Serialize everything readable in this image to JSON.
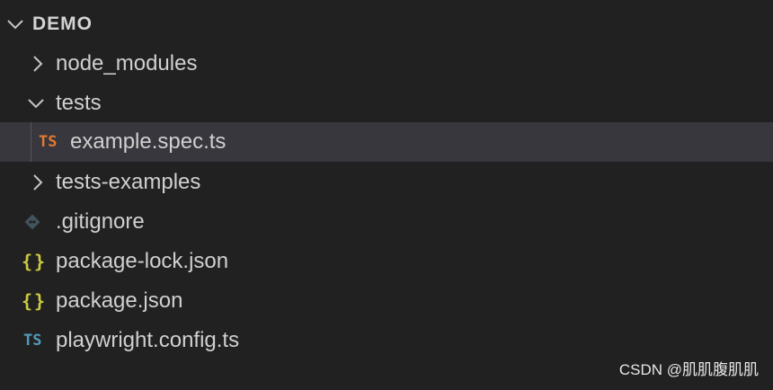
{
  "explorer": {
    "section_title": "DEMO",
    "items": [
      {
        "label": "node_modules",
        "kind": "folder",
        "expanded": false,
        "icon": "chevron-right-icon"
      },
      {
        "label": "tests",
        "kind": "folder",
        "expanded": true,
        "icon": "chevron-down-icon"
      },
      {
        "label": "example.spec.ts",
        "kind": "file",
        "icon_text": "TS",
        "icon": "typescript-icon",
        "selected": true
      },
      {
        "label": "tests-examples",
        "kind": "folder",
        "expanded": false,
        "icon": "chevron-right-icon"
      },
      {
        "label": ".gitignore",
        "kind": "file",
        "icon": "git-icon"
      },
      {
        "label": "package-lock.json",
        "kind": "file",
        "icon_text": "{}",
        "icon": "json-icon"
      },
      {
        "label": "package.json",
        "kind": "file",
        "icon_text": "{}",
        "icon": "json-icon"
      },
      {
        "label": "playwright.config.ts",
        "kind": "file",
        "icon_text": "TS",
        "icon": "typescript-icon"
      }
    ]
  },
  "watermark": "CSDN @肌肌腹肌肌",
  "colors": {
    "background": "#212121",
    "selected_row": "#37373d",
    "ts_orange": "#e37933",
    "ts_blue": "#519aba",
    "json_yellow": "#cbcb41",
    "git_icon": "#41535b"
  }
}
